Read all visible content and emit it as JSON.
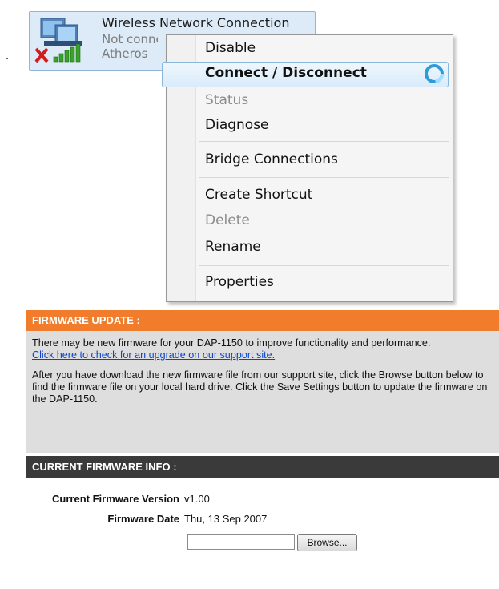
{
  "connection": {
    "title": "Wireless Network Connection",
    "status": "Not connected",
    "adapter": "Atheros"
  },
  "context_menu": {
    "items": [
      {
        "label": "Disable"
      },
      {
        "label": "Connect / Disconnect"
      },
      {
        "label": "Status"
      },
      {
        "label": "Diagnose"
      },
      {
        "label": "Bridge Connections"
      },
      {
        "label": "Create Shortcut"
      },
      {
        "label": "Delete"
      },
      {
        "label": "Rename"
      },
      {
        "label": "Properties"
      }
    ],
    "highlighted_item": "Connect / Disconnect",
    "disabled_items": [
      "Status",
      "Delete"
    ]
  },
  "firmware_update": {
    "title": "FIRMWARE UPDATE :",
    "intro": "There may be new firmware for your DAP-1150 to improve functionality and performance.",
    "link": "Click here to check for an upgrade on our support site.",
    "instructions": "After you have download the new firmware file from our support site, click the Browse button below to find the firmware file on your local hard drive. Click the Save Settings button to update the firmware on the DAP-1150."
  },
  "current_firmware": {
    "title": "CURRENT FIRMWARE INFO :",
    "version_label": "Current Firmware Version",
    "version_value": "v1.00",
    "date_label": "Firmware Date",
    "date_value": "Thu, 13 Sep 2007",
    "file_input_value": "",
    "browse_label": "Browse..."
  },
  "colors": {
    "firmware_header": "#f07c2c",
    "current_header": "#3a3a3a",
    "menu_highlight": "#d9ebfa",
    "link": "#0a44cc"
  }
}
